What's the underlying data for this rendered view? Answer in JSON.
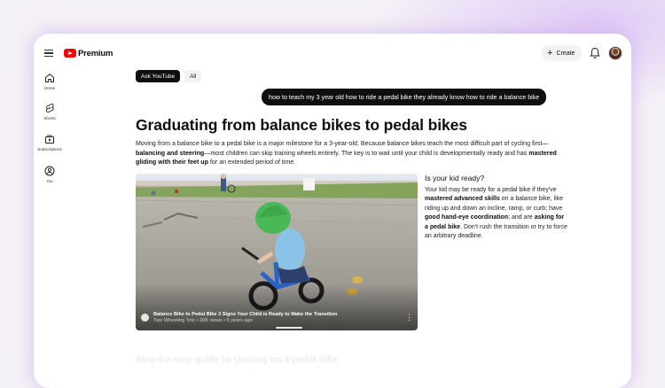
{
  "app": {
    "logo_text": "Premium",
    "brand_color": "#ff0000"
  },
  "header": {
    "create_label": "Create",
    "create_icon": "plus-icon",
    "notifications_icon": "bell-icon"
  },
  "sidebar": {
    "items": [
      {
        "label": "Home",
        "icon": "home-icon"
      },
      {
        "label": "Shorts",
        "icon": "shorts-icon"
      },
      {
        "label": "Subscriptions",
        "icon": "subscriptions-icon"
      },
      {
        "label": "You",
        "icon": "you-icon"
      }
    ]
  },
  "chips": [
    {
      "label": "Ask YouTube",
      "active": true
    },
    {
      "label": "All",
      "active": false
    }
  ],
  "query": "how to teach my 3 year old how to ride a pedal bike they already know how to ride a balance bike",
  "article": {
    "heading": "Graduating from balance bikes to pedal bikes",
    "intro": {
      "p1": "Moving from a balance bike to a pedal bike is a major milestone for a 3-year-old. Because balance bikes teach the most difficult part of cycling first—",
      "b1": "balancing and steering",
      "p2": "—most children can skip training wheels entirely. The key is to wait until your child is developmentally ready and has ",
      "b2": "mastered gliding with their feet up",
      "p3": " for an extended period of time."
    },
    "side": {
      "title": "Is your kid ready?",
      "t1": "Your kid may be ready for a pedal bike if they've ",
      "b1": "mastered advanced skills",
      "t2": " on a balance bike, like riding up and down an incline, ramp, or curb; have ",
      "b2": "good hand-eye coordination",
      "t3": "; and are ",
      "b3": "asking for a pedal bike",
      "t4": ". Don't rush the transition or try to force an arbitrary deadline."
    },
    "next_heading": "Step-by-step guide to starting on a pedal bike"
  },
  "video": {
    "title": "Balance Bike to Pedal Bike 3 Signs Your Child is Ready to Make the Transition",
    "meta": "Two Wheeling Tots • 20K views • 5 years ago",
    "menu_icon": "more-vert-icon"
  }
}
